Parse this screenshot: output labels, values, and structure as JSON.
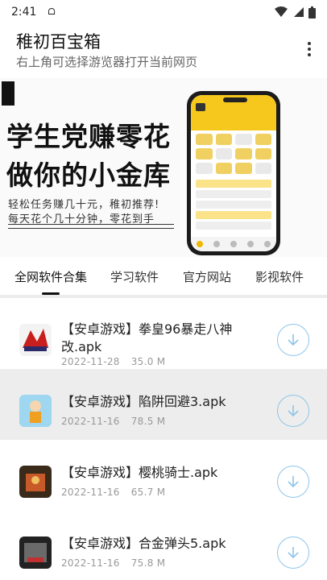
{
  "status": {
    "time": "2:41",
    "carrier_glyph": "ᗝ",
    "icons": [
      "wifi-icon",
      "signal-icon",
      "battery-icon"
    ]
  },
  "appbar": {
    "title": "稚初百宝箱",
    "subtitle": "右上角可选择游览器打开当前网页",
    "overflow_icon": "more-vert-icon"
  },
  "banner": {
    "headline_1": "学生党赚零花",
    "headline_2": "做你的小金库",
    "line_1": "轻松任务赚几十元，稚初推荐!",
    "line_2": "每天花个几十分钟，零花到手"
  },
  "tabs": [
    {
      "label": "全网软件合集",
      "active": true
    },
    {
      "label": "学习软件",
      "active": false
    },
    {
      "label": "官方网站",
      "active": false
    },
    {
      "label": "影视软件",
      "active": false
    }
  ],
  "items": [
    {
      "title": "【安卓游戏】拳皇96暴走八神改.apk",
      "date": "2022-11-28",
      "size": "35.0 M",
      "icon": "kof-game-icon",
      "highlight": false
    },
    {
      "title": "【安卓游戏】陷阱回避3.apk",
      "date": "2022-11-16",
      "size": "78.5 M",
      "icon": "trap-game-icon",
      "highlight": true
    },
    {
      "title": "【安卓游戏】樱桃骑士.apk",
      "date": "2022-11-16",
      "size": "65.7 M",
      "icon": "cherry-knight-icon",
      "highlight": false
    },
    {
      "title": "【安卓游戏】合金弹头5.apk",
      "date": "2022-11-16",
      "size": "75.8 M",
      "icon": "metal-slug-icon",
      "highlight": false
    }
  ],
  "colors": {
    "accent": "#8ec5ea",
    "phone_yellow": "#f6c81e",
    "highlight_row": "#ededed"
  }
}
